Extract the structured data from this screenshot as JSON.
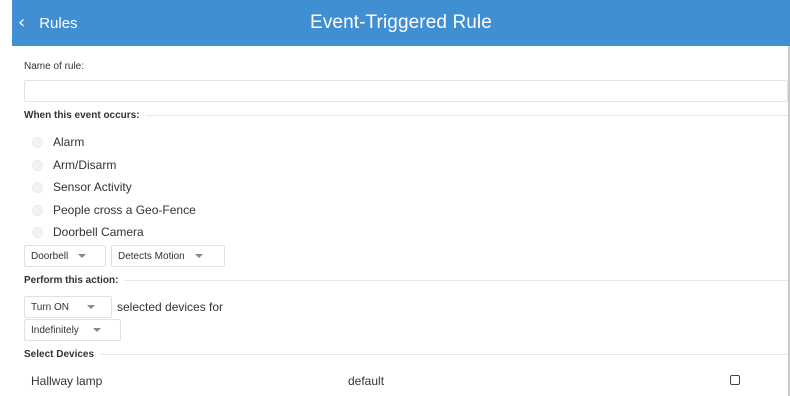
{
  "header": {
    "back_label": "Rules",
    "title": "Event-Triggered Rule",
    "background_color": "#3f8fd2"
  },
  "name_section": {
    "label": "Name of rule:",
    "input_value": "",
    "placeholder": ""
  },
  "event_section": {
    "title": "When this event occurs:",
    "options": [
      {
        "label": "Alarm",
        "selected": false
      },
      {
        "label": "Arm/Disarm",
        "selected": false
      },
      {
        "label": "Sensor Activity",
        "selected": false
      },
      {
        "label": "People cross a Geo-Fence",
        "selected": false
      },
      {
        "label": "Doorbell Camera",
        "selected": false
      }
    ],
    "camera_select": "Doorbell",
    "trigger_select": "Detects Motion"
  },
  "action_section": {
    "title": "Perform this action:",
    "action_select": "Turn ON",
    "middle_text": "selected devices for",
    "duration_select": "Indefinitely"
  },
  "devices_section": {
    "title": "Select Devices",
    "devices": [
      {
        "name": "Hallway lamp",
        "mode": "default",
        "checked": false
      }
    ]
  },
  "icons": {
    "back": "chevron-left-icon",
    "dropdown": "caret-down-icon"
  }
}
